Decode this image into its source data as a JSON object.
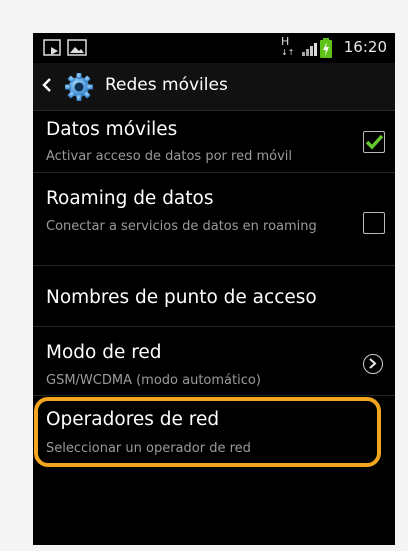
{
  "status_bar": {
    "time": "16:20",
    "network_type": "H",
    "icons": [
      "download-icon",
      "image-icon",
      "hspa-icon",
      "signal-icon",
      "battery-icon"
    ],
    "battery_color": "#5ec219"
  },
  "action_bar": {
    "title": "Redes móviles",
    "icons": [
      "back-icon",
      "settings-gear-icon"
    ]
  },
  "settings": [
    {
      "title": "Datos móviles",
      "subtitle": "Activar acceso de datos por red móvil",
      "control": "checkbox",
      "checked": true
    },
    {
      "title": "Roaming de datos",
      "subtitle": "Conectar a servicios de datos en roaming",
      "control": "checkbox",
      "checked": false
    },
    {
      "title": "Nombres de punto de acceso",
      "subtitle": "",
      "control": "none"
    },
    {
      "title": "Modo de red",
      "subtitle": "GSM/WCDMA (modo automático)",
      "control": "chevron"
    },
    {
      "title": "Operadores de red",
      "subtitle": "Seleccionar un operador de red",
      "control": "none",
      "highlighted": true
    }
  ],
  "colors": {
    "accent_highlight": "#f2a521",
    "check_green": "#62c82c",
    "background": "#000000"
  }
}
